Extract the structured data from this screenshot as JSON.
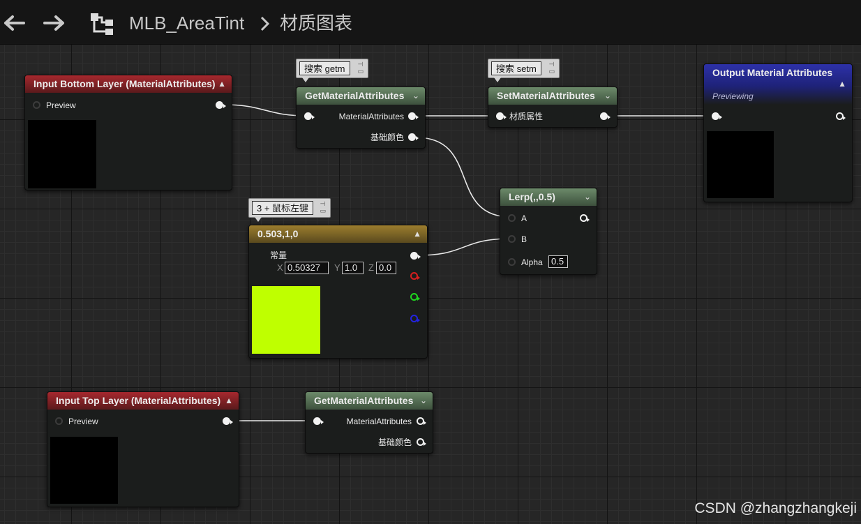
{
  "toolbar": {
    "back_icon": "arrow-left-icon",
    "forward_icon": "arrow-right-icon",
    "graph_icon": "material-graph-icon",
    "asset_name": "MLB_AreaTint",
    "separator_icon": "chevron-right-icon",
    "graph_name": "材质图表"
  },
  "colors": {
    "header_red": "#a6282e",
    "header_green": "#6c8a6a",
    "header_gold": "#9c7d2e",
    "header_blue": "#2d31a8",
    "constant_swatch": "#bfff00"
  },
  "comments": {
    "get": {
      "text": "搜索 getm"
    },
    "set": {
      "text": "搜索 setm"
    },
    "constant": {
      "text": "3 + 鼠标左键"
    }
  },
  "nodes": {
    "input_bottom": {
      "title": "Input Bottom Layer (MaterialAttributes)",
      "out_label": "Preview"
    },
    "get_top": {
      "title": "GetMaterialAttributes",
      "pin_material": "MaterialAttributes",
      "pin_basecolor": "基础颜色"
    },
    "set": {
      "title": "SetMaterialAttributes",
      "pin_material": "材质属性"
    },
    "output": {
      "title": "Output Material Attributes",
      "subtitle": "Previewing"
    },
    "lerp": {
      "title": "Lerp(,,0.5)",
      "pin_a": "A",
      "pin_b": "B",
      "pin_alpha": "Alpha",
      "alpha_value": "0.5"
    },
    "constant": {
      "title": "0.503,1,0",
      "label": "常量",
      "x_label": "X",
      "x_value": "0.50327",
      "y_label": "Y",
      "y_value": "1.0",
      "z_label": "Z",
      "z_value": "0.0"
    },
    "input_top": {
      "title": "Input Top Layer (MaterialAttributes)",
      "out_label": "Preview"
    },
    "get_bottom": {
      "title": "GetMaterialAttributes",
      "pin_material": "MaterialAttributes",
      "pin_basecolor": "基础颜色"
    }
  },
  "watermark": "CSDN @zhangzhangkeji"
}
